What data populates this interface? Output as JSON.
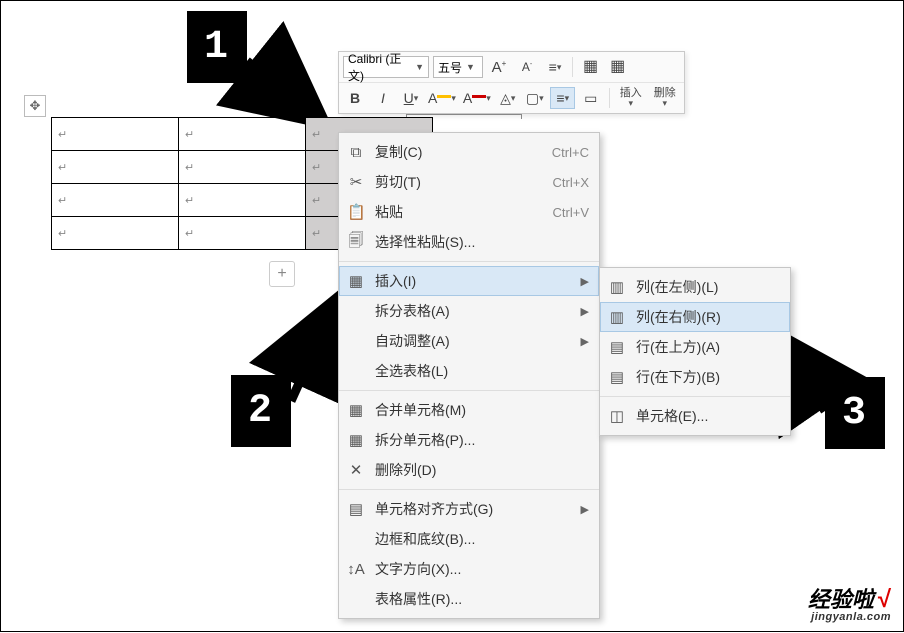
{
  "toolbar": {
    "font_name": "Calibri (正文)",
    "font_size": "五号",
    "grow_font": "A",
    "shrink_font": "A",
    "bold": "B",
    "italic": "I",
    "underline": "U",
    "insert_label": "插入",
    "delete_label": "删除"
  },
  "table": {
    "cell_marker": "↵"
  },
  "context_menu": {
    "copy": "复制(C)",
    "copy_sc": "Ctrl+C",
    "cut": "剪切(T)",
    "cut_sc": "Ctrl+X",
    "paste": "粘贴",
    "paste_sc": "Ctrl+V",
    "paste_special": "选择性粘贴(S)...",
    "insert": "插入(I)",
    "split_table": "拆分表格(A)",
    "auto_fit": "自动调整(A)",
    "select_table": "全选表格(L)",
    "merge_cells": "合并单元格(M)",
    "split_cells": "拆分单元格(P)...",
    "delete_col": "删除列(D)",
    "cell_align": "单元格对齐方式(G)",
    "borders_shading": "边框和底纹(B)...",
    "text_direction": "文字方向(X)...",
    "table_props": "表格属性(R)..."
  },
  "submenu": {
    "col_left": "列(在左侧)(L)",
    "col_right": "列(在右侧)(R)",
    "row_above": "行(在上方)(A)",
    "row_below": "行(在下方)(B)",
    "cells": "单元格(E)..."
  },
  "callouts": {
    "n1": "1",
    "n2": "2",
    "n3": "3"
  },
  "watermark": {
    "line1": "经验啦",
    "check": "√",
    "line2": "jingyanla.com"
  }
}
